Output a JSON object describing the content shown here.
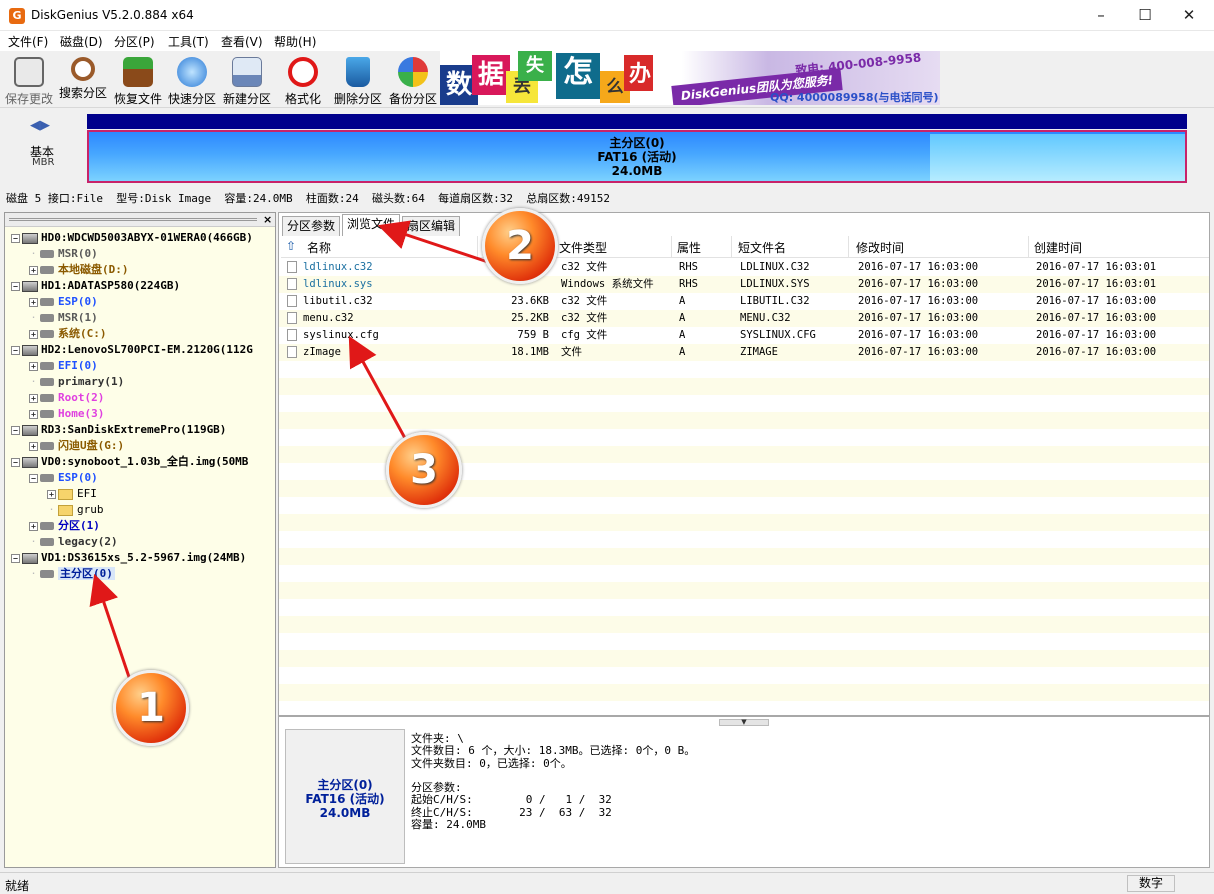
{
  "window": {
    "title": "DiskGenius V5.2.0.884 x64",
    "icon": "G"
  },
  "menu": [
    "文件(F)",
    "磁盘(D)",
    "分区(P)",
    "工具(T)",
    "查看(V)",
    "帮助(H)"
  ],
  "toolbar": [
    {
      "label": "保存更改",
      "icon": "save-icon"
    },
    {
      "label": "搜索分区",
      "icon": "magnifier-icon"
    },
    {
      "label": "恢复文件",
      "icon": "recover-box-icon"
    },
    {
      "label": "快速分区",
      "icon": "quick-partition-icon"
    },
    {
      "label": "新建分区",
      "icon": "new-partition-icon"
    },
    {
      "label": "格式化",
      "icon": "format-icon"
    },
    {
      "label": "删除分区",
      "icon": "trash-icon"
    },
    {
      "label": "备份分区",
      "icon": "backup-icon"
    }
  ],
  "banner": {
    "chars": [
      "数",
      "据",
      "丢",
      "失",
      "怎",
      "么",
      "办"
    ],
    "slogan": "DiskGenius团队为您服务!",
    "phone": "致电: 400-008-9958",
    "qq": "QQ: 4000089958(与电话同号)"
  },
  "disk_map": {
    "type": "基本",
    "style": "MBR",
    "partition": {
      "name": "主分区(0)",
      "fs": "FAT16 (活动)",
      "size": "24.0MB"
    },
    "info": "磁盘 5 接口:File  型号:Disk Image  容量:24.0MB  柱面数:24  磁头数:64  每道扇区数:32  总扇区数:49152"
  },
  "tree": [
    {
      "label": "HD0:WDCWD5003ABYX-01WERA0(466GB)",
      "kind": "disk",
      "level": 0,
      "color": "#000000",
      "expander": "−"
    },
    {
      "label": "MSR(0)",
      "kind": "part",
      "level": 1,
      "color": "#5a5a5a",
      "expander": ""
    },
    {
      "label": "本地磁盘(D:)",
      "kind": "part",
      "level": 1,
      "color": "#8b5a00",
      "expander": "+"
    },
    {
      "label": "HD1:ADATASP580(224GB)",
      "kind": "disk",
      "level": 0,
      "color": "#000000",
      "expander": "−"
    },
    {
      "label": "ESP(0)",
      "kind": "part",
      "level": 1,
      "color": "#1e50ff",
      "expander": "+"
    },
    {
      "label": "MSR(1)",
      "kind": "part",
      "level": 1,
      "color": "#5a5a5a",
      "expander": ""
    },
    {
      "label": "系统(C:)",
      "kind": "part",
      "level": 1,
      "color": "#8b5a00",
      "expander": "+"
    },
    {
      "label": "HD2:LenovoSL700PCI-EM.2120G(112G",
      "kind": "disk",
      "level": 0,
      "color": "#000000",
      "expander": "−"
    },
    {
      "label": "EFI(0)",
      "kind": "part",
      "level": 1,
      "color": "#1e50ff",
      "expander": "+"
    },
    {
      "label": "primary(1)",
      "kind": "part",
      "level": 1,
      "color": "#333333",
      "expander": ""
    },
    {
      "label": "Root(2)",
      "kind": "part",
      "level": 1,
      "color": "#e040e0",
      "expander": "+"
    },
    {
      "label": "Home(3)",
      "kind": "part",
      "level": 1,
      "color": "#e040e0",
      "expander": "+"
    },
    {
      "label": "RD3:SanDiskExtremePro(119GB)",
      "kind": "disk",
      "level": 0,
      "color": "#000000",
      "expander": "−"
    },
    {
      "label": "闪迪U盘(G:)",
      "kind": "part",
      "level": 1,
      "color": "#8b5a00",
      "expander": "+"
    },
    {
      "label": "VD0:synoboot_1.03b_全白.img(50MB",
      "kind": "disk",
      "level": 0,
      "color": "#000000",
      "expander": "−"
    },
    {
      "label": "ESP(0)",
      "kind": "part",
      "level": 1,
      "color": "#1e50ff",
      "expander": "−"
    },
    {
      "label": "EFI",
      "kind": "folder",
      "level": 2,
      "color": "#000000",
      "expander": "+"
    },
    {
      "label": "grub",
      "kind": "folder",
      "level": 2,
      "color": "#000000",
      "expander": ""
    },
    {
      "label": "分区(1)",
      "kind": "part",
      "level": 1,
      "color": "#0000c0",
      "expander": "+"
    },
    {
      "label": "legacy(2)",
      "kind": "part",
      "level": 1,
      "color": "#333333",
      "expander": ""
    },
    {
      "label": "VD1:DS3615xs_5.2-5967.img(24MB)",
      "kind": "disk",
      "level": 0,
      "color": "#000000",
      "expander": "−"
    },
    {
      "label": "主分区(0)",
      "kind": "part",
      "level": 1,
      "color": "#00209a",
      "expander": "",
      "selected": true
    }
  ],
  "tabs": [
    "分区参数",
    "浏览文件",
    "扇区编辑"
  ],
  "columns": [
    "名称",
    "大小",
    "文件类型",
    "属性",
    "短文件名",
    "修改时间",
    "创建时间"
  ],
  "files": [
    {
      "name": "ldlinux.c32",
      "size": "",
      "type": "c32 文件",
      "attr": "RHS",
      "short": "LDLINUX.C32",
      "mtime": "2016-07-17 16:03:00",
      "ctime": "2016-07-17 16:03:01",
      "color": "#1a6fa0"
    },
    {
      "name": "ldlinux.sys",
      "size": "",
      "type": "Windows 系统文件",
      "attr": "RHS",
      "short": "LDLINUX.SYS",
      "mtime": "2016-07-17 16:03:00",
      "ctime": "2016-07-17 16:03:01",
      "color": "#1a6fa0"
    },
    {
      "name": "libutil.c32",
      "size": "23.6KB",
      "type": "c32 文件",
      "attr": "A",
      "short": "LIBUTIL.C32",
      "mtime": "2016-07-17 16:03:00",
      "ctime": "2016-07-17 16:03:00",
      "color": "#000000"
    },
    {
      "name": "menu.c32",
      "size": "25.2KB",
      "type": "c32 文件",
      "attr": "A",
      "short": "MENU.C32",
      "mtime": "2016-07-17 16:03:00",
      "ctime": "2016-07-17 16:03:00",
      "color": "#000000"
    },
    {
      "name": "syslinux.cfg",
      "size": "759 B",
      "type": "cfg 文件",
      "attr": "A",
      "short": "SYSLINUX.CFG",
      "mtime": "2016-07-17 16:03:00",
      "ctime": "2016-07-17 16:03:00",
      "color": "#000000"
    },
    {
      "name": "zImage",
      "size": "18.1MB",
      "type": "文件",
      "attr": "A",
      "short": "ZIMAGE",
      "mtime": "2016-07-17 16:03:00",
      "ctime": "2016-07-17 16:03:00",
      "color": "#000000"
    }
  ],
  "bottom": {
    "partition": {
      "name": "主分区(0)",
      "fs": "FAT16 (活动)",
      "size": "24.0MB"
    },
    "info": "文件夹: \\\n文件数目: 6 个，大小: 18.3MB。已选择: 0个，0 B。\n文件夹数目: 0，已选择: 0个。\n\n分区参数:\n起始C/H/S:        0 /   1 /  32\n终止C/H/S:       23 /  63 /  32\n容量: 24.0MB"
  },
  "status": {
    "text": "就绪",
    "numlock": "数字"
  },
  "callouts": [
    "1",
    "2",
    "3"
  ]
}
